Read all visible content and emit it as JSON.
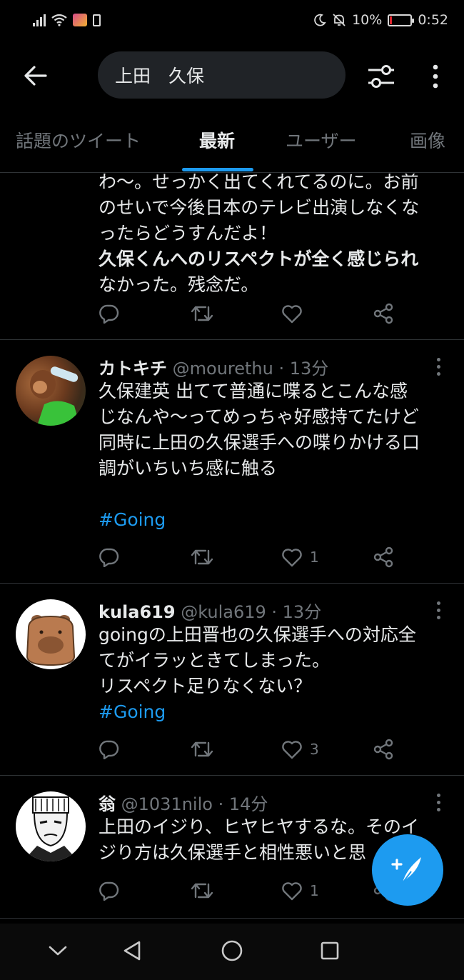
{
  "status_bar": {
    "battery_text": "10%",
    "time": "0:52",
    "battery_color": "#e0252e"
  },
  "search": {
    "query": "上田　久保"
  },
  "tabs": [
    {
      "label": "話題のツイート",
      "active": false
    },
    {
      "label": "最新",
      "active": true
    },
    {
      "label": "ユーザー",
      "active": false
    },
    {
      "label": "画像",
      "active": false
    }
  ],
  "tweets": [
    {
      "partial": true,
      "lines": [
        "わ〜。せっかく出てくれてるのに。お前",
        "のせいで今後日本のテレビ出演しなくな",
        "ったらどうすんだよ！",
        "久保くんへのリスペクトが全く感じられ",
        "なかった。残念だ。"
      ],
      "like_count": ""
    },
    {
      "name": "カトキチ",
      "handle": "@mourethu · 13分",
      "lines": [
        "久保建英 出てて普通に喋るとこんな感",
        "じなんや〜ってめっちゃ好感持てたけど",
        "同時に上田の久保選手への喋りかける口",
        "調がいちいち感に触る"
      ],
      "hashtag": "#Going",
      "like_count": "1",
      "avatar": "monkey-photo"
    },
    {
      "name": "kula619",
      "handle": "@kula619 · 13分",
      "lines": [
        "goingの上田晋也の久保選手への対応全",
        "てがイラッときてしまった。",
        "リスペクト足りなくない？"
      ],
      "hashtag": "#Going",
      "like_count": "3",
      "avatar": "capybara-illustration"
    },
    {
      "name": "翁",
      "handle": "@1031nilo · 14分",
      "lines": [
        "上田のイジり、ヒヤヒヤするな。そのイ",
        "ジり方は久保選手と相性悪いと思"
      ],
      "like_count": "1",
      "avatar": "manga-chef"
    }
  ],
  "colors": {
    "accent": "#1d9bf0",
    "background": "#000000",
    "muted_text": "#71767b",
    "divider": "#2f3336"
  }
}
